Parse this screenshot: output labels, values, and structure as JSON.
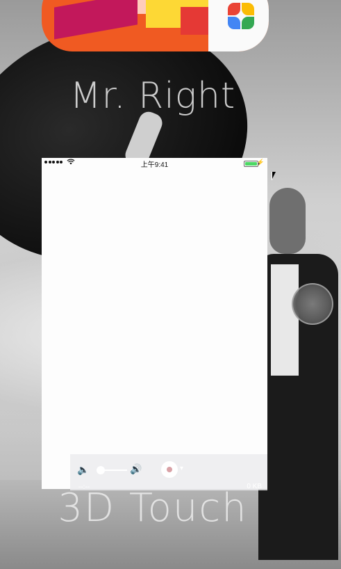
{
  "background": {
    "title_top": "Mr. Right",
    "title_bottom": "3D Touch"
  },
  "status_bar": {
    "time": "上午9:41",
    "wifi_icon": "wifi-icon",
    "battery_color": "#4cd964"
  },
  "recorder": {
    "volume_low_icon": "speaker-low-icon",
    "volume_high_icon": "speaker-high-icon",
    "volume_level": 0.1,
    "record_icon": "record-icon",
    "elapsed_time": "--:--",
    "file_size": "0 KB"
  },
  "assistive_touch": {
    "icon": "assistive-touch-icon"
  }
}
